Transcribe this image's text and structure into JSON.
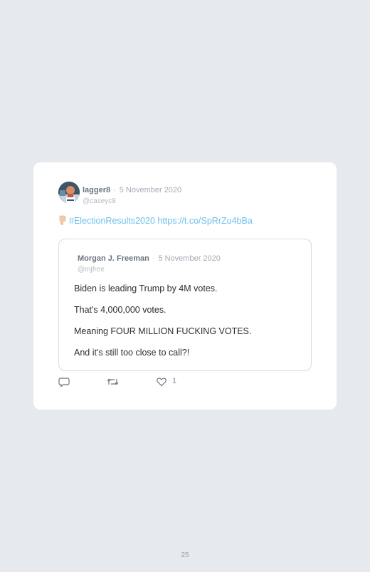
{
  "tweet": {
    "author_name": "lagger8",
    "separator": "·",
    "date": "5 November 2020",
    "handle": "@caseyc8",
    "text": "#ElectionResults2020 https://t.co/SpRrZu4bBa",
    "emoji": "thumbs-down-icon"
  },
  "quoted_tweet": {
    "author_name": "Morgan J. Freeman",
    "separator": "·",
    "date": "5 November 2020",
    "handle": "@mjfree",
    "lines": [
      "Biden is leading Trump by 4M votes.",
      "That's 4,000,000 votes.",
      "Meaning FOUR MILLION FUCKING VOTES.",
      "And it's still too close to call?!"
    ]
  },
  "actions": {
    "reply_icon": "reply-icon",
    "retweet_icon": "retweet-icon",
    "like_icon": "heart-icon",
    "like_count": "1"
  },
  "page": {
    "number": "25"
  },
  "colors": {
    "background": "#e6e9ee",
    "card": "#ffffff",
    "link": "#6ec0ea"
  }
}
